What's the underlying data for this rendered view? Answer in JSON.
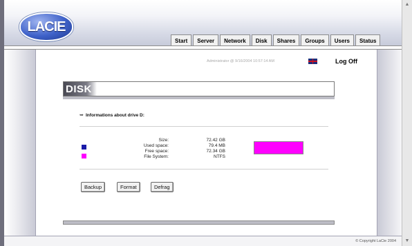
{
  "brand": {
    "logo_text": "LACIE"
  },
  "nav": {
    "tabs": [
      "Start",
      "Server",
      "Network",
      "Disk",
      "Shares",
      "Groups",
      "Users",
      "Status"
    ]
  },
  "session": {
    "admin_text": "Administrator @ 9/16/2004 10:57:14 AM",
    "logoff_label": "Log Off"
  },
  "page": {
    "title": "DISK"
  },
  "drive": {
    "heading": "Informations about drive",
    "drive_letter": "D:",
    "rows": [
      {
        "label": "Size:",
        "value": "72.42 GB"
      },
      {
        "label": "Used space:",
        "value": "79.4 MB"
      },
      {
        "label": "Free space:",
        "value": "72.34 GB"
      },
      {
        "label": "File System:",
        "value": "NTFS"
      }
    ],
    "used_fraction": 0.001,
    "colors": {
      "used": "#1a1aa8",
      "free": "#ff00ff"
    }
  },
  "actions": {
    "backup_label": "Backup",
    "format_label": "Format",
    "defrag_label": "Defrag"
  },
  "footer": {
    "copyright": "© Copyright LaCie 2004"
  },
  "icons": {
    "scroll_up": "scroll-up-icon",
    "scroll_down": "scroll-down-icon",
    "info": "drive-info-icon",
    "flag": "uk-flag-icon"
  }
}
